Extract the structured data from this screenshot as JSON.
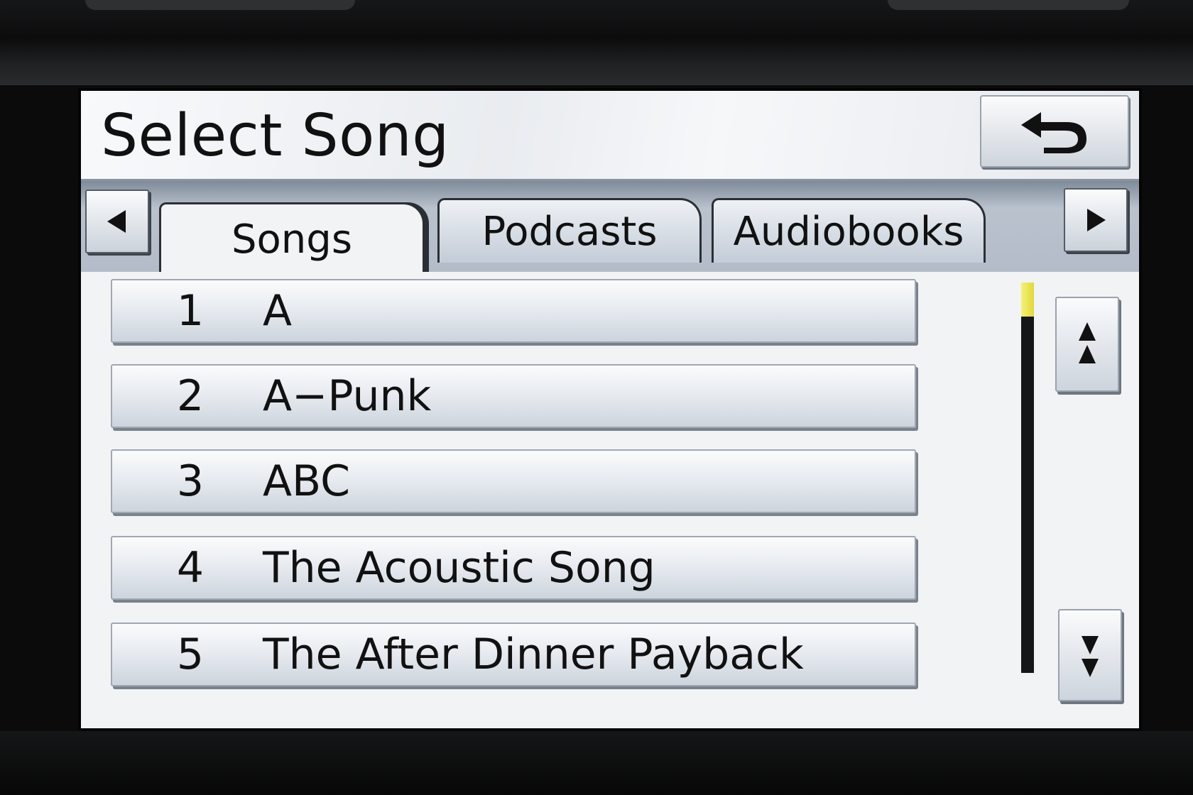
{
  "screen": {
    "title": "Select Song",
    "back_icon": "back-arrow-icon"
  },
  "tabs": [
    {
      "label": "Songs",
      "active": true
    },
    {
      "label": "Podcasts",
      "active": false
    },
    {
      "label": "Audiobooks",
      "active": false
    }
  ],
  "tab_nav": {
    "prev_icon": "triangle-left-icon",
    "next_icon": "triangle-right-icon"
  },
  "songs": [
    {
      "number": "1",
      "title": "A"
    },
    {
      "number": "2",
      "title": "A−Punk"
    },
    {
      "number": "3",
      "title": "ABC"
    },
    {
      "number": "4",
      "title": "The Acoustic Song"
    },
    {
      "number": "5",
      "title": "The After Dinner Payback"
    }
  ],
  "scroll": {
    "position_fraction": 0.0,
    "page_up_icon": "double-chevron-up-icon",
    "page_down_icon": "double-chevron-down-icon"
  },
  "colors": {
    "scroll_thumb": "#e8e04a",
    "text": "#111111"
  }
}
